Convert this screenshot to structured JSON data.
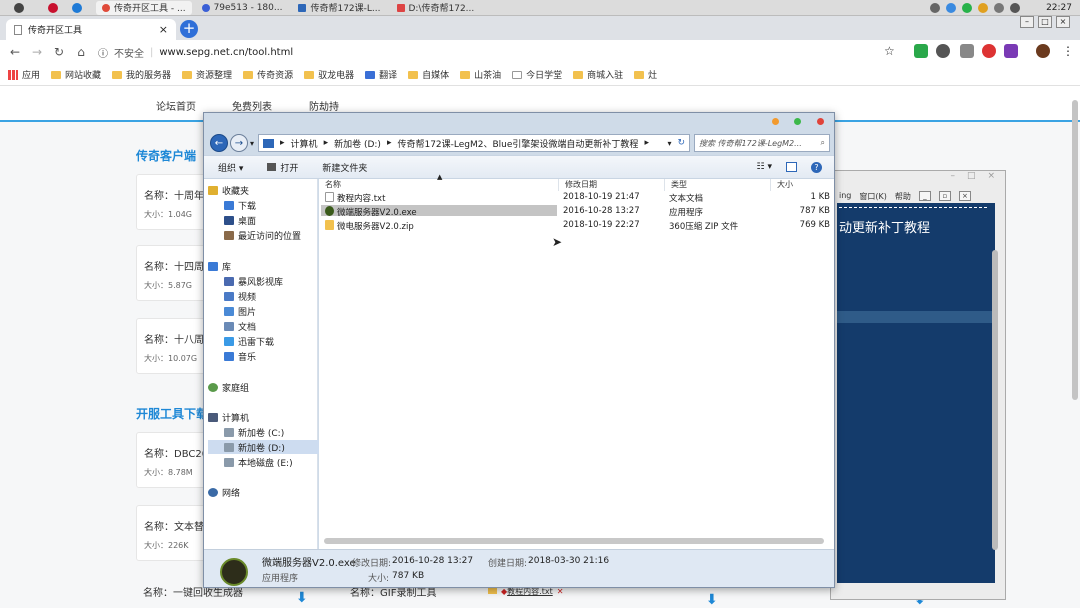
{
  "mac_bar": {
    "tabs": [
      {
        "label": "传奇开区工具 - ..."
      },
      {
        "label": "79e513 - 180..."
      },
      {
        "label": "传奇帮172课-L..."
      },
      {
        "label": "D:\\传奇帮172..."
      }
    ],
    "clock": "22:27"
  },
  "chrome": {
    "tab_title": "传奇开区工具",
    "insecure_label": "不安全",
    "url": "www.sepg.net.cn/tool.html"
  },
  "bookmarks": {
    "items": [
      {
        "label": "应用"
      },
      {
        "label": "网站收藏"
      },
      {
        "label": "我的服务器"
      },
      {
        "label": "资源整理"
      },
      {
        "label": "传奇资源"
      },
      {
        "label": "驭龙电器"
      },
      {
        "label": "翻译"
      },
      {
        "label": "自媒体"
      },
      {
        "label": "山茶油"
      },
      {
        "label": "今日学堂"
      },
      {
        "label": "商城入驻"
      },
      {
        "label": "灶"
      }
    ]
  },
  "site": {
    "nav": [
      "论坛首页",
      "免费列表",
      "防劫持"
    ],
    "section1_title": "传奇客户端",
    "section2_title": "开服工具下载",
    "cards": [
      {
        "name": "名称：十周年",
        "size": "大小：1.04G"
      },
      {
        "name": "名称：十四周",
        "size": "大小：5.87G"
      },
      {
        "name": "名称：十八周",
        "size": "大小：10.07G"
      },
      {
        "name": "名称：DBC20",
        "size": "大小：8.78M"
      },
      {
        "name": "名称：文本替",
        "size": "大小：226K"
      }
    ],
    "bottom_card_1": "名称：一键回收生成器",
    "bottom_card_2": "名称：GIF录制工具"
  },
  "cmd_window": {
    "menu": [
      "ing",
      "窗口(K)",
      "帮助"
    ],
    "text": "动更新补丁教程"
  },
  "explorer": {
    "breadcrumb": [
      "计算机",
      "新加卷 (D:)",
      "传奇帮172课-LegM2、Blue引擎架设微端自动更新补丁教程"
    ],
    "search_placeholder": "搜索 传奇帮172课-LegM2...",
    "toolbar": {
      "organize": "组织",
      "open": "打开",
      "new_folder": "新建文件夹"
    },
    "nav": {
      "favorites": "收藏夹",
      "downloads": "下载",
      "desktop": "桌面",
      "recent": "最近访问的位置",
      "libraries": "库",
      "storm": "暴风影视库",
      "video": "视频",
      "pictures": "图片",
      "docs": "文档",
      "thunder": "迅雷下载",
      "music": "音乐",
      "homegroup": "家庭组",
      "computer": "计算机",
      "drive_c": "新加卷 (C:)",
      "drive_d": "新加卷 (D:)",
      "drive_e": "本地磁盘 (E:)",
      "network": "网络"
    },
    "columns": {
      "name": "名称",
      "modified": "修改日期",
      "type": "类型",
      "size": "大小"
    },
    "files": [
      {
        "name": "教程内容.txt",
        "modified": "2018-10-19 21:47",
        "type": "文本文档",
        "size": "1 KB"
      },
      {
        "name": "微端服务器V2.0.exe",
        "modified": "2016-10-28 13:27",
        "type": "应用程序",
        "size": "787 KB"
      },
      {
        "name": "微电服务器V2.0.zip",
        "modified": "2018-10-19 22:27",
        "type": "360压缩 ZIP 文件",
        "size": "769 KB"
      }
    ],
    "status": {
      "filename": "微端服务器V2.0.exe",
      "modified_label": "修改日期:",
      "modified": "2016-10-28 13:27",
      "created_label": "创建日期:",
      "created": "2018-03-30 21:16",
      "type": "应用程序",
      "size_label": "大小:",
      "size": "787 KB"
    }
  },
  "taskbar_file": "教程内容.txt"
}
